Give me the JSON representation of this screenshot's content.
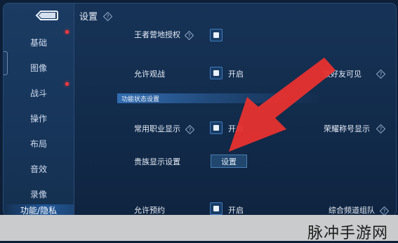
{
  "header": {
    "title": "设置"
  },
  "sidebar": {
    "items": [
      {
        "label": "基础"
      },
      {
        "label": "图像"
      },
      {
        "label": "战斗"
      },
      {
        "label": "操作"
      },
      {
        "label": "布局"
      },
      {
        "label": "音效"
      },
      {
        "label": "录像"
      },
      {
        "label": "功能/隐私"
      }
    ],
    "active_index": 7
  },
  "settings": {
    "king_territory": {
      "label": "王者营地授权"
    },
    "allow_watch": {
      "label": "允许观战",
      "state": "开启"
    },
    "friend_visible": {
      "label": "放好友可见"
    },
    "section": {
      "title": "功能状态设置"
    },
    "profession": {
      "label": "常用职业显示",
      "state": "开启"
    },
    "honor_title": {
      "label": "荣耀称号显示"
    },
    "noble": {
      "label": "贵族显示设置",
      "button": "设置"
    },
    "allow_reserve": {
      "label": "允许预约",
      "state": "开启"
    },
    "channel_team": {
      "label": "综合频道组队"
    }
  },
  "colors": {
    "panel_bg": "#163357",
    "sidebar_bg": "#1b3b62",
    "accent_blue": "#3a8be0",
    "red_arrow": "#e8322f",
    "dot_red": "#ff3a3a"
  },
  "icons": {
    "back": "back-arrow-icon",
    "help": "help-diamond-icon"
  },
  "watermark": {
    "text": "脉冲手游网"
  }
}
